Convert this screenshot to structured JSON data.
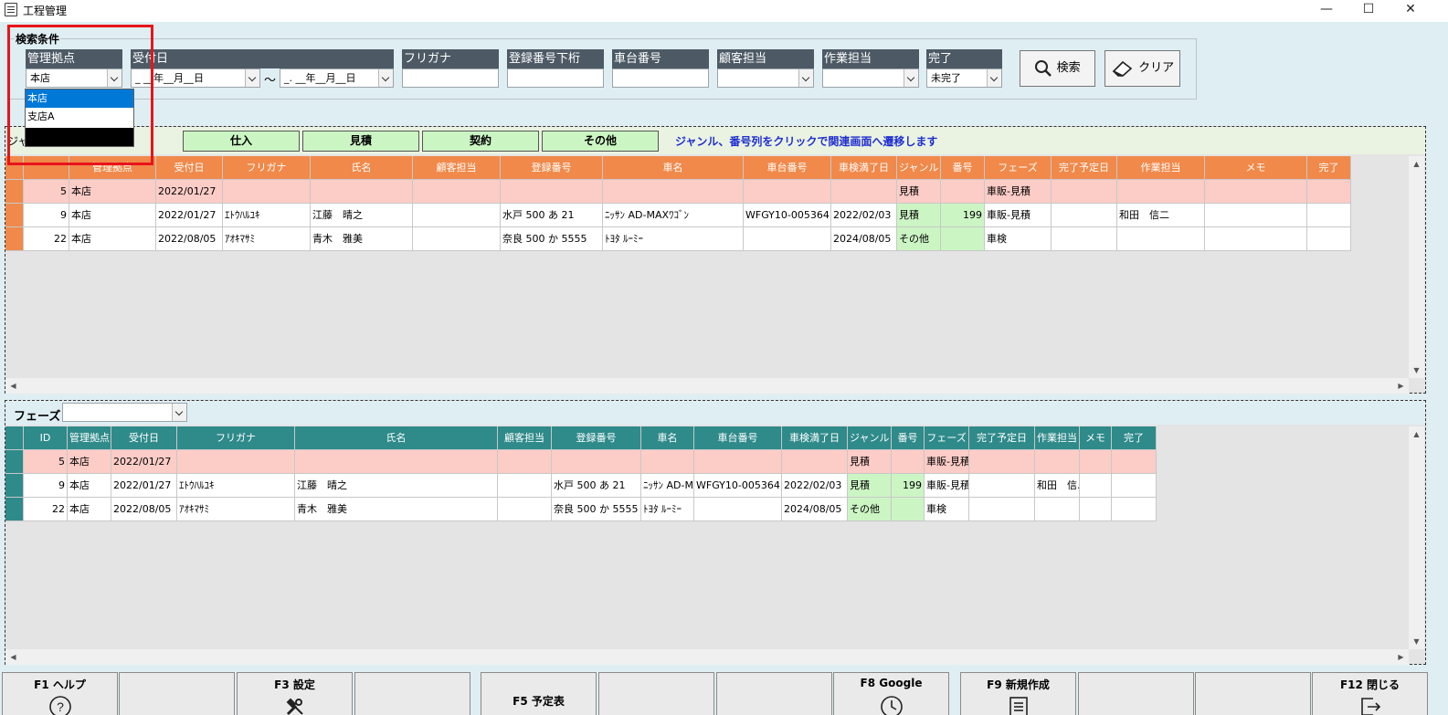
{
  "window": {
    "title": "工程管理",
    "controls": {
      "minimize": "—",
      "maximize": "☐",
      "close": "✕"
    }
  },
  "search": {
    "legend": "検索条件",
    "labels": {
      "branch": "管理拠点",
      "date": "受付日",
      "furigana": "フリガナ",
      "reg_lower": "登録番号下桁",
      "chassis": "車台番号",
      "customer_rep": "顧客担当",
      "work_rep": "作業担当",
      "done": "完了"
    },
    "branch_value": "本店",
    "date_from": "_ __年__月__日",
    "date_to": "_. __年__月__日",
    "tilde": "～",
    "done_value": "未完了",
    "search_button": "検索",
    "clear_button": "クリア",
    "branch_options": [
      "本店",
      "支店A"
    ]
  },
  "genre": {
    "prefix": "ジャ",
    "buttons": [
      "仕入",
      "見積",
      "契約",
      "その他"
    ],
    "note": "ジャンル、番号列をクリックで関連画面へ遷移します"
  },
  "top_table": {
    "headers": [
      "",
      "",
      "管理拠点",
      "受付日",
      "フリガナ",
      "氏名",
      "顧客担当",
      "登録番号",
      "車名",
      "車台番号",
      "車検満了日",
      "ジャンル",
      "番号",
      "フェーズ",
      "完了予定日",
      "作業担当",
      "メモ",
      "完了"
    ],
    "rows": [
      [
        "",
        "5",
        "本店",
        "2022/01/27",
        "",
        "",
        "",
        "",
        "",
        "",
        "",
        "見積",
        "",
        "車販-見積",
        "",
        "",
        "",
        ""
      ],
      [
        "",
        "9",
        "本店",
        "2022/01/27",
        "ｴﾄｳﾊﾙﾕｷ",
        "江藤　晴之",
        "",
        "水戸 500 あ 21",
        "ﾆｯｻﾝ AD-MAXﾜｺﾞﾝ",
        "WFGY10-005364",
        "2022/02/03",
        "見積",
        "199",
        "車販-見積",
        "",
        "和田　信二",
        "",
        ""
      ],
      [
        "",
        "22",
        "本店",
        "2022/08/05",
        "ｱｵｷﾏｻﾐ",
        "青木　雅美",
        "",
        "奈良 500 か 5555",
        "ﾄﾖﾀ ﾙｰﾐｰ",
        "",
        "2024/08/05",
        "その他",
        "",
        "車検",
        "",
        "",
        "",
        ""
      ]
    ]
  },
  "phase": {
    "label": "フェーズ",
    "value": ""
  },
  "bottom_table": {
    "headers": [
      "",
      "ID",
      "管理拠点",
      "受付日",
      "フリガナ",
      "氏名",
      "顧客担当",
      "登録番号",
      "車名",
      "車台番号",
      "車検満了日",
      "ジャンル",
      "番号",
      "フェーズ",
      "完了予定日",
      "作業担当",
      "メモ",
      "完了"
    ],
    "rows": [
      [
        "",
        "5",
        "本店",
        "2022/01/27",
        "",
        "",
        "",
        "",
        "",
        "",
        "",
        "見積",
        "",
        "車販-見積",
        "",
        "",
        "",
        ""
      ],
      [
        "",
        "9",
        "本店",
        "2022/01/27",
        "ｴﾄｳﾊﾙﾕｷ",
        "江藤　晴之",
        "",
        "水戸 500 あ 21",
        "ﾆｯｻﾝ AD-M",
        "WFGY10-005364",
        "2022/02/03",
        "見積",
        "199",
        "車販-見積",
        "",
        "和田　信.",
        "",
        ""
      ],
      [
        "",
        "22",
        "本店",
        "2022/08/05",
        "ｱｵｷﾏｻﾐ",
        "青木　雅美",
        "",
        "奈良 500 か 5555",
        "ﾄﾖﾀ ﾙｰﾐｰ",
        "",
        "2024/08/05",
        "その他",
        "",
        "車検",
        "",
        "",
        "",
        ""
      ]
    ]
  },
  "function_keys": [
    {
      "label": "F1 ヘルプ",
      "icon": "help-icon"
    },
    {
      "label": "",
      "icon": ""
    },
    {
      "label": "F3 設定",
      "icon": "tools-icon"
    },
    {
      "label": "",
      "icon": ""
    },
    {
      "label": "F5 予定表",
      "icon": ""
    },
    {
      "label": "",
      "icon": ""
    },
    {
      "label": "",
      "icon": ""
    },
    {
      "label": "F8 Google",
      "icon": "clock-icon"
    },
    {
      "label": "F9 新規作成",
      "icon": "document-icon"
    },
    {
      "label": "",
      "icon": ""
    },
    {
      "label": "",
      "icon": ""
    },
    {
      "label": "F12 閉じる",
      "icon": "exit-icon"
    }
  ],
  "colors": {
    "top_header": "#f0894a",
    "bottom_header": "#2f8a8a",
    "pink_row": "#fcccc7",
    "green_cell": "#ccf5c4",
    "selected_option": "#0078d7",
    "highlight": "#e8141b"
  }
}
